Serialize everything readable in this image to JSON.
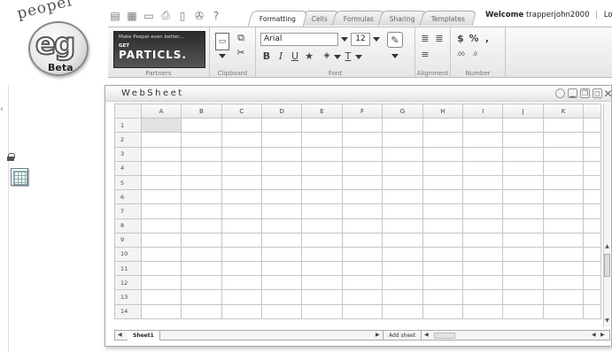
{
  "logo": {
    "word": "peopel",
    "mark": "eg",
    "badge": "Beta"
  },
  "quick_toolbar": [
    "new-icon",
    "grid-icon",
    "open-icon",
    "print-icon",
    "document-icon",
    "settings-icon",
    "help-icon"
  ],
  "help_glyph": "?",
  "tabs": [
    {
      "label": "Formatting",
      "active": true
    },
    {
      "label": "Cells",
      "active": false
    },
    {
      "label": "Formulas",
      "active": false
    },
    {
      "label": "Sharing",
      "active": false
    },
    {
      "label": "Templates",
      "active": false
    }
  ],
  "header": {
    "welcome": "Welcome",
    "username": "trapperjohn2000",
    "separator": "|",
    "logout": "Logou"
  },
  "ribbon": {
    "partners": {
      "label": "Partners",
      "promo_line1": "Make Peepel even better...",
      "promo_line2": "GET",
      "promo_line3": "PARTICLS."
    },
    "clipboard": {
      "label": "Clipboard"
    },
    "font": {
      "label": "Font",
      "family": "Arial",
      "size": "12",
      "bold": "B",
      "italic": "I",
      "underline": "U",
      "strike": "A",
      "text_color": "T"
    },
    "alignment": {
      "label": "Alignment"
    },
    "number": {
      "label": "Number",
      "currency": "$",
      "percent": "%",
      "comma": ",",
      "inc_decimal": ".00",
      "dec_decimal": ".0"
    }
  },
  "websheet": {
    "title": "WebSheet",
    "columns": [
      "A",
      "B",
      "C",
      "D",
      "E",
      "F",
      "G",
      "H",
      "I",
      "J",
      "K"
    ],
    "rows": [
      "1",
      "2",
      "3",
      "4",
      "5",
      "6",
      "7",
      "8",
      "9",
      "10",
      "11",
      "12",
      "13",
      "14"
    ],
    "selected_cell": "A1",
    "sheet_tab": "Sheet1",
    "add_sheet": "Add sheet"
  }
}
